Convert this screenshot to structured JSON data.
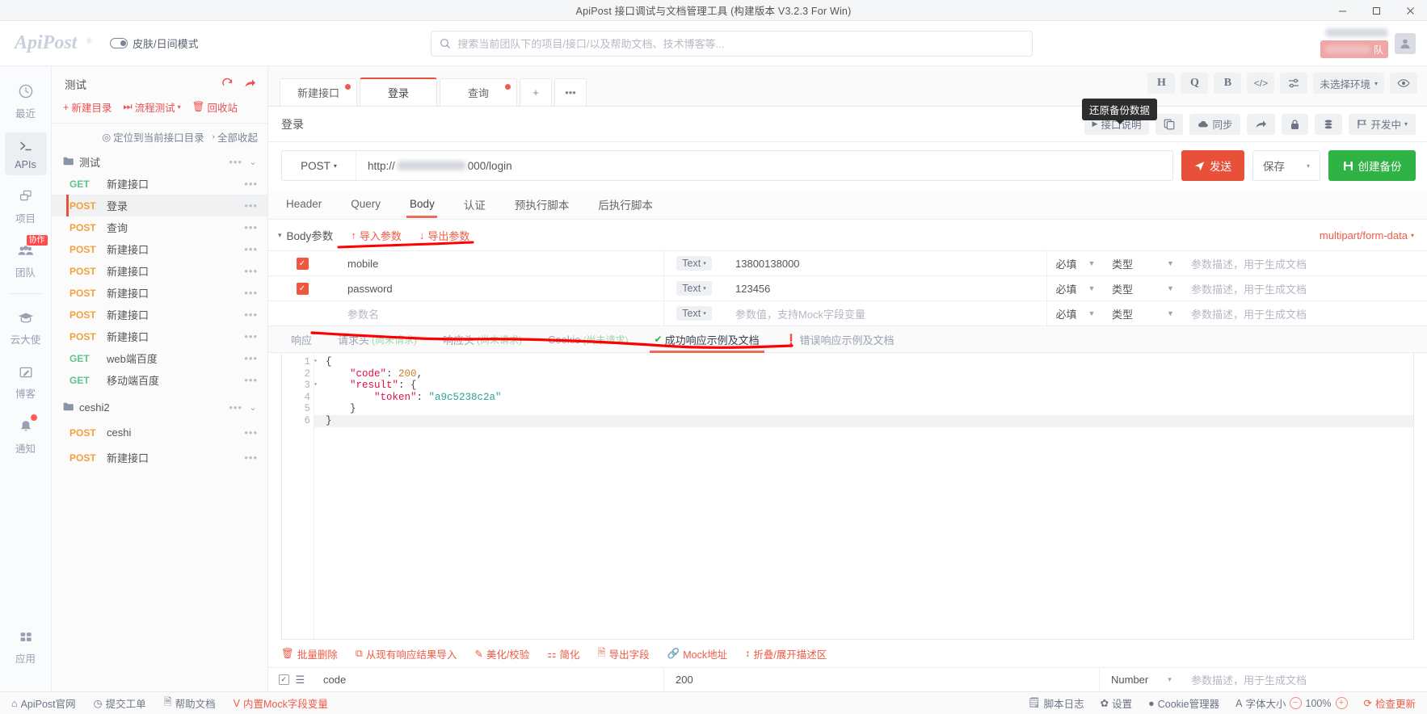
{
  "window": {
    "title": "ApiPost 接口调试与文档管理工具 (构建版本 V3.2.3 For Win)",
    "minimize": "─",
    "maximize": "□",
    "close": "✕"
  },
  "header": {
    "logo": "ApiPost",
    "logo_reg": "®",
    "skin_label": "皮肤/日间模式",
    "search_placeholder": "搜索当前团队下的项目/接口/以及帮助文档、技术博客等...",
    "team_chip_label": "队"
  },
  "rail": {
    "items": [
      {
        "label": "最近",
        "icon": "clock-icon",
        "active": false,
        "badge": "",
        "dot": false
      },
      {
        "label": "APIs",
        "icon": "terminal-icon",
        "active": true,
        "badge": "",
        "dot": false
      },
      {
        "label": "项目",
        "icon": "project-icon",
        "active": false,
        "badge": "",
        "dot": false
      },
      {
        "label": "团队",
        "icon": "team-icon",
        "active": false,
        "badge": "协作",
        "dot": false
      },
      {
        "label": "云大使",
        "icon": "graduation-cap-icon",
        "active": false,
        "badge": "",
        "dot": false
      },
      {
        "label": "博客",
        "icon": "edit-square-icon",
        "active": false,
        "badge": "",
        "dot": false
      },
      {
        "label": "通知",
        "icon": "bell-icon",
        "active": false,
        "badge": "",
        "dot": true
      }
    ],
    "bottom": {
      "label": "应用",
      "icon": "grid-icon"
    }
  },
  "tree": {
    "project_name": "测试",
    "refresh_icon": "refresh-icon",
    "share_icon": "share-arrow-icon",
    "actions": [
      {
        "label": "新建目录",
        "icon": "plus-icon",
        "caret": false
      },
      {
        "label": "流程测试",
        "icon": "flow-icon",
        "caret": true
      },
      {
        "label": "回收站",
        "icon": "trash-icon",
        "caret": false
      }
    ],
    "locate_label": "定位到当前接口目录",
    "collapse_label": "全部收起",
    "nodes": [
      {
        "type": "folder",
        "name": "测试",
        "dots": "•••",
        "chevron": "⌄"
      },
      {
        "type": "api",
        "method": "GET",
        "name": "新建接口",
        "selected": false
      },
      {
        "type": "api",
        "method": "POST",
        "name": "登录",
        "selected": true
      },
      {
        "type": "api",
        "method": "POST",
        "name": "查询",
        "selected": false
      },
      {
        "type": "api",
        "method": "POST",
        "name": "新建接口",
        "selected": false
      },
      {
        "type": "api",
        "method": "POST",
        "name": "新建接口",
        "selected": false
      },
      {
        "type": "api",
        "method": "POST",
        "name": "新建接口",
        "selected": false
      },
      {
        "type": "api",
        "method": "POST",
        "name": "新建接口",
        "selected": false
      },
      {
        "type": "api",
        "method": "POST",
        "name": "新建接口",
        "selected": false
      },
      {
        "type": "api",
        "method": "GET",
        "name": "web端百度",
        "selected": false
      },
      {
        "type": "api",
        "method": "GET",
        "name": "移动端百度",
        "selected": false
      },
      {
        "type": "folder",
        "name": "ceshi2",
        "dots": "•••",
        "chevron": "⌄"
      },
      {
        "type": "api",
        "method": "POST",
        "name": "ceshi",
        "selected": false
      },
      {
        "type": "api",
        "method": "POST",
        "name": "新建接口",
        "selected": false
      }
    ]
  },
  "tabs": [
    {
      "label": "新建接口",
      "active": false,
      "dot": true
    },
    {
      "label": "登录",
      "active": true,
      "dot": false
    },
    {
      "label": "查询",
      "active": false,
      "dot": true
    },
    {
      "label": "+",
      "active": false,
      "dot": false,
      "mini": true
    },
    {
      "label": "•••",
      "active": false,
      "dot": false,
      "mini": true
    }
  ],
  "top_tools": [
    {
      "label": "H",
      "name": "header-tool-button"
    },
    {
      "label": "Q",
      "name": "query-tool-button"
    },
    {
      "label": "B",
      "name": "body-tool-button"
    },
    {
      "label": "</>",
      "name": "code-tool-button"
    },
    {
      "label": "⇌",
      "name": "settings-sliders-button"
    },
    {
      "label": "未选择环境",
      "name": "environment-select",
      "caret": "▾"
    },
    {
      "label": "◉",
      "name": "eye-preview-button"
    }
  ],
  "api": {
    "title": "登录",
    "toolbar": [
      {
        "label": "接口说明",
        "icon": "play-icon",
        "name": "api-description-button"
      },
      {
        "label": "",
        "icon": "copy-icon",
        "name": "copy-button"
      },
      {
        "label": "同步",
        "icon": "cloud-sync-icon",
        "name": "sync-button"
      },
      {
        "label": "",
        "icon": "share-arrow-icon",
        "name": "share-button"
      },
      {
        "label": "",
        "icon": "lock-icon",
        "name": "lock-button"
      },
      {
        "label": "",
        "icon": "database-stack-icon",
        "name": "restore-backup-button"
      },
      {
        "label": "开发中",
        "icon": "flag-icon",
        "name": "status-select",
        "caret": "▾"
      }
    ],
    "tooltip": "还原备份数据",
    "method": "POST",
    "url_prefix": "http://",
    "url_suffix": "000/login",
    "send_label": "发送",
    "send_icon": "send-icon",
    "save_label": "保存",
    "save_caret": "▾",
    "create_backup_label": "创建备份",
    "create_backup_icon": "save-disk-icon"
  },
  "request_tabs": [
    {
      "label": "Header",
      "active": false
    },
    {
      "label": "Query",
      "active": false
    },
    {
      "label": "Body",
      "active": true
    },
    {
      "label": "认证",
      "active": false
    },
    {
      "label": "预执行脚本",
      "active": false
    },
    {
      "label": "后执行脚本",
      "active": false
    }
  ],
  "params": {
    "section_title": "Body参数",
    "caret": "▾",
    "import_label": "导入参数",
    "export_label": "导出参数",
    "body_type": "multipart/form-data",
    "body_type_caret": "▾",
    "columns": {
      "required": "必填",
      "type": "类型",
      "description_placeholder": "参数描述，用于生成文档"
    },
    "rows": [
      {
        "checked": true,
        "name": "mobile",
        "type": "Text",
        "value": "13800138000",
        "required": "必填",
        "vtype": "类型",
        "desc": "参数描述，用于生成文档",
        "placeholder_row": false
      },
      {
        "checked": true,
        "name": "password",
        "type": "Text",
        "value": "123456",
        "required": "必填",
        "vtype": "类型",
        "desc": "参数描述，用于生成文档",
        "placeholder_row": false
      },
      {
        "checked": false,
        "name": "参数名",
        "type": "Text",
        "value": "参数值，支持Mock字段变量",
        "required": "必填",
        "vtype": "类型",
        "desc": "参数描述，用于生成文档",
        "placeholder_row": true
      }
    ]
  },
  "response_tabs": [
    {
      "label": "响应",
      "hint": "",
      "active": false,
      "icon": ""
    },
    {
      "label": "请求头",
      "hint": "(尚未请求)",
      "active": false,
      "icon": ""
    },
    {
      "label": "响应头",
      "hint": "(尚未请求)",
      "active": false,
      "icon": ""
    },
    {
      "label": "Cookie",
      "hint": "(尚未请求)",
      "active": false,
      "icon": ""
    },
    {
      "label": "成功响应示例及文档",
      "hint": "",
      "active": true,
      "icon": "check-circle-icon"
    },
    {
      "label": "错误响应示例及文档",
      "hint": "",
      "active": false,
      "icon": "error-circle-icon"
    }
  ],
  "editor": {
    "lines": [
      {
        "no": "1",
        "fold": true,
        "text": "{"
      },
      {
        "no": "2",
        "fold": false,
        "text": "    \"code\": 200,"
      },
      {
        "no": "3",
        "fold": true,
        "text": "    \"result\": {"
      },
      {
        "no": "4",
        "fold": false,
        "text": "        \"token\": \"a9c5238c2a\""
      },
      {
        "no": "5",
        "fold": false,
        "text": "    }"
      },
      {
        "no": "6",
        "fold": false,
        "text": "}"
      }
    ]
  },
  "editor_actions": [
    {
      "label": "批量删除",
      "icon": "trash-icon"
    },
    {
      "label": "从现有响应结果导入",
      "icon": "import-icon"
    },
    {
      "label": "美化/校验",
      "icon": "wand-icon"
    },
    {
      "label": "简化",
      "icon": "compress-icon"
    },
    {
      "label": "导出字段",
      "icon": "export-doc-icon"
    },
    {
      "label": "Mock地址",
      "icon": "link-icon"
    },
    {
      "label": "折叠/展开描述区",
      "icon": "collapse-icon"
    }
  ],
  "schema_row": {
    "checked": true,
    "menu_icon": "list-icon",
    "field": "code",
    "value": "200",
    "type": "Number",
    "type_caret": "▾",
    "desc": "参数描述，用于生成文档"
  },
  "statusbar": {
    "left": [
      {
        "label": "ApiPost官网",
        "icon": "home-icon",
        "red": false
      },
      {
        "label": "提交工单",
        "icon": "question-circle-icon",
        "red": false
      },
      {
        "label": "帮助文档",
        "icon": "doc-icon",
        "red": false
      },
      {
        "label": "内置Mock字段变量",
        "icon": "v-icon",
        "red": true
      }
    ],
    "right": [
      {
        "label": "脚本日志",
        "icon": "log-icon",
        "red": false
      },
      {
        "label": "设置",
        "icon": "gear-icon",
        "red": false
      },
      {
        "label": "Cookie管理器",
        "icon": "cookie-icon",
        "red": false
      },
      {
        "label": "字体大小",
        "icon": "font-size-icon",
        "red": false
      }
    ],
    "zoom": "100%",
    "zoom_out": "−",
    "zoom_in": "+",
    "update_label": "检查更新",
    "update_icon": "refresh-icon"
  },
  "colors": {
    "accent": "#e8503a",
    "green": "#2fb344",
    "get_method": "#62c18d",
    "post_method": "#f0a13c",
    "annotation": "#ff0000"
  }
}
